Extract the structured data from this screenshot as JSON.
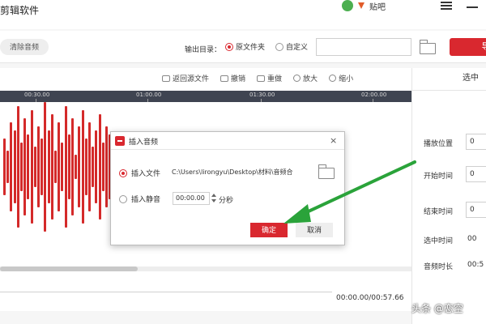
{
  "app": {
    "title": "剪辑软件",
    "username": "贴吧"
  },
  "toolbar": {
    "clear_label": "清除音频",
    "output_label": "输出目录：",
    "option_source": "原文件夹",
    "option_custom": "自定义",
    "path_value": "",
    "export_label": "导"
  },
  "editor": {
    "actions": {
      "restore": "返回源文件",
      "undo": "撤销",
      "redo": "重做",
      "zoom_in": "放大",
      "zoom_out": "缩小"
    },
    "ruler_labels": [
      "00:30.00",
      "01:00.00",
      "01:30.00",
      "02:00.00"
    ],
    "time_readout": "00:00.00/00:57.66"
  },
  "panel": {
    "header": "选中",
    "play_position_label": "播放位置",
    "play_position_value": "0",
    "start_label": "开始时间",
    "start_value": "0",
    "end_label": "结束时间",
    "end_value": "0",
    "selected_label": "选中时间",
    "selected_value": "00",
    "duration_label": "音频时长",
    "duration_value": "00:5"
  },
  "dialog": {
    "title": "插入音频",
    "close": "×",
    "insert_file_label": "插入文件",
    "file_path": "C:\\Users\\lirongyu\\Desktop\\材料\\音频合",
    "insert_silence_label": "插入静音",
    "silence_value": "00:00.00",
    "silence_unit": "分秒",
    "ok_label": "确定",
    "cancel_label": "取消"
  },
  "watermark": "头条 @恋空",
  "colors": {
    "accent": "#d9282f",
    "waveform": "#d42a2a",
    "ruler_bg": "#3f4451",
    "arrow": "#2aa33a"
  }
}
